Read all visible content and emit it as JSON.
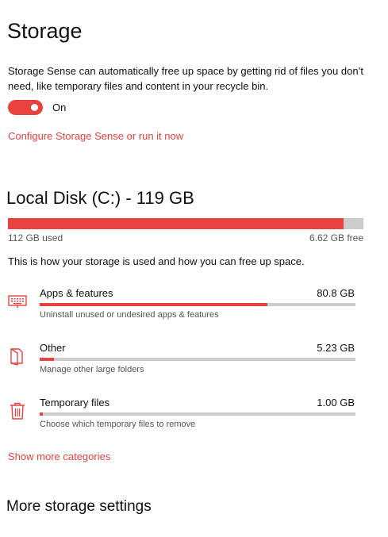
{
  "page": {
    "title": "Storage",
    "storage_sense_description": "Storage Sense can automatically free up space by getting rid of files you don’t need, like temporary files and content in your recycle bin.",
    "toggle_label": "On",
    "toggle_on": true,
    "configure_link": "Configure Storage Sense or run it now"
  },
  "disk": {
    "title": "Local Disk (C:) - 119 GB",
    "used_label": "112 GB used",
    "free_label": "6.62 GB free",
    "used_fraction": 0.944,
    "intro": "This is how your storage is used and how you can free up space."
  },
  "categories": [
    {
      "name": "Apps & features",
      "size": "80.8 GB",
      "description": "Uninstall unused or undesired apps & features",
      "icon": "keyboard-icon",
      "fraction": 0.72
    },
    {
      "name": "Other",
      "size": "5.23 GB",
      "description": "Manage other large folders",
      "icon": "folder-icon",
      "fraction": 0.045
    },
    {
      "name": "Temporary files",
      "size": "1.00 GB",
      "description": "Choose which temporary files to remove",
      "icon": "trash-icon",
      "fraction": 0.009
    }
  ],
  "show_more_link": "Show more categories",
  "more_settings": {
    "title": "More storage settings"
  },
  "colors": {
    "accent": "#e8413f",
    "track": "#cccccc"
  }
}
